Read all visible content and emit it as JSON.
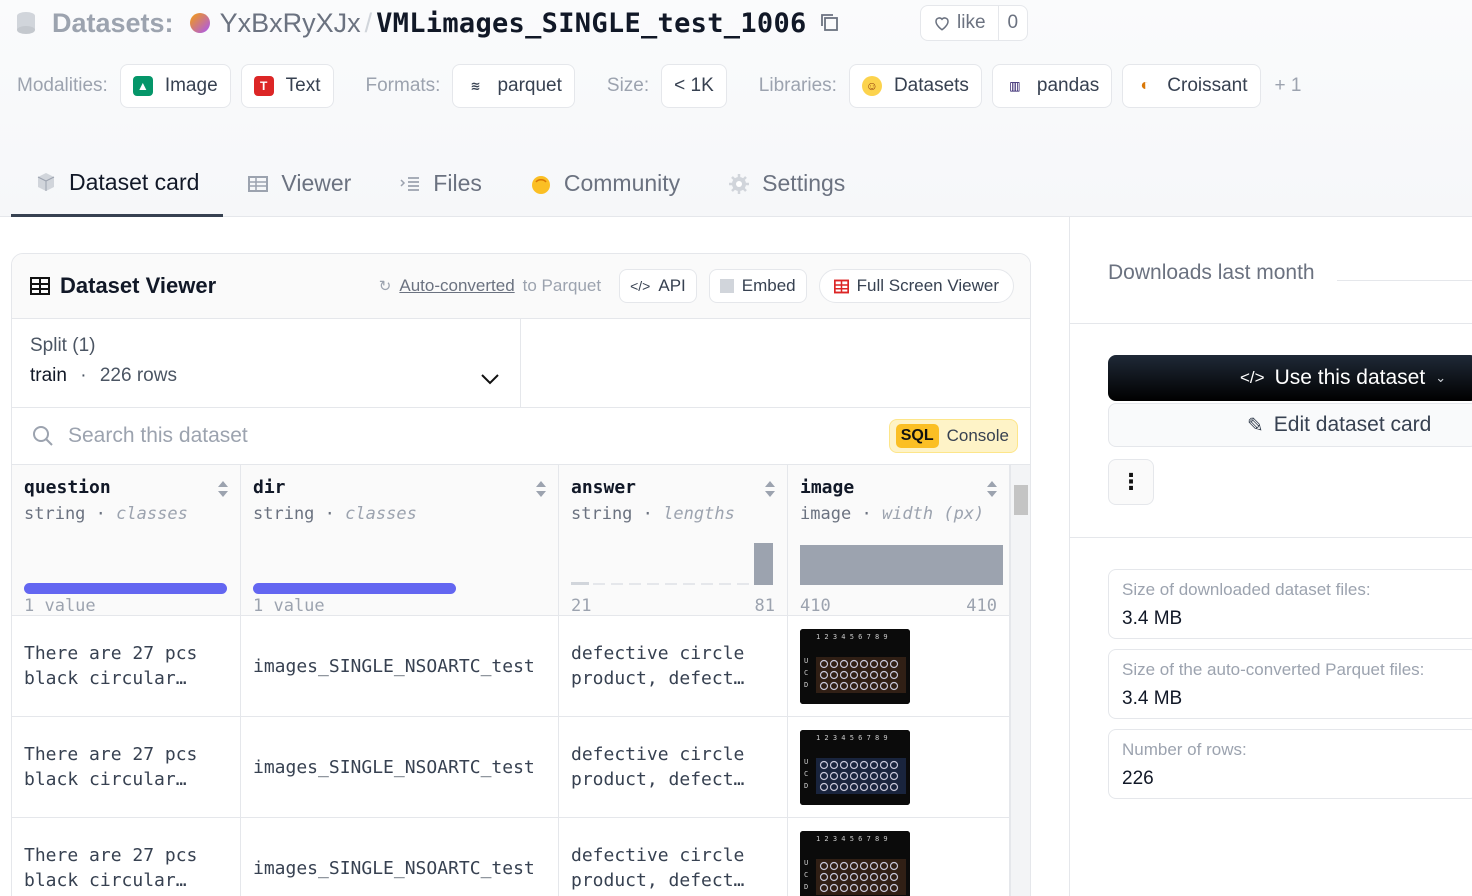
{
  "breadcrumb": {
    "label": "Datasets:",
    "org": "YxBxRyXJx",
    "separator": "/",
    "name": "VMLimages_SINGLE_test_1006"
  },
  "like": {
    "label": "like",
    "count": "0"
  },
  "tags": {
    "modalities_label": "Modalities:",
    "modalities": [
      "Image",
      "Text"
    ],
    "formats_label": "Formats:",
    "formats": [
      "parquet"
    ],
    "size_label": "Size:",
    "size": "< 1K",
    "libraries_label": "Libraries:",
    "libraries": [
      "Datasets",
      "pandas",
      "Croissant"
    ],
    "more": "+ 1"
  },
  "tabs": [
    {
      "label": "Dataset card",
      "icon": "cube-icon",
      "active": true
    },
    {
      "label": "Viewer",
      "icon": "table-icon"
    },
    {
      "label": "Files",
      "icon": "files-icon"
    },
    {
      "label": "Community",
      "icon": "community-icon"
    },
    {
      "label": "Settings",
      "icon": "gear-icon"
    }
  ],
  "viewer": {
    "title": "Dataset Viewer",
    "auto_link": "Auto-converted",
    "auto_rest": "to Parquet",
    "api": "API",
    "embed": "Embed",
    "fullscreen": "Full Screen Viewer",
    "split_label": "Split (1)",
    "split_name": "train",
    "split_dot": "·",
    "split_rows": "226 rows",
    "search_placeholder": "Search this dataset",
    "sql_badge": "SQL",
    "sql_label": "Console",
    "columns": [
      {
        "name": "question",
        "type": "string",
        "stat": "classes",
        "footer_left": "1 value",
        "footer_right": ""
      },
      {
        "name": "dir",
        "type": "string",
        "stat": "classes",
        "footer_left": "1 value",
        "footer_right": ""
      },
      {
        "name": "answer",
        "type": "string",
        "stat": "lengths",
        "footer_left": "21",
        "footer_right": "81"
      },
      {
        "name": "image",
        "type": "image",
        "stat": "width (px)",
        "footer_left": "410",
        "footer_right": "410"
      }
    ],
    "type_sep": "·",
    "rows": [
      {
        "question": "There are 27 pcs black circular…",
        "dir": "images_SINGLE_NSOARTC_test",
        "answer": "defective circle product, defect…"
      },
      {
        "question": "There are 27 pcs black circular…",
        "dir": "images_SINGLE_NSOARTC_test",
        "answer": "defective circle product, defect…"
      },
      {
        "question": "There are 27 pcs black circular…",
        "dir": "images_SINGLE_NSOARTC_test",
        "answer": "defective circle product, defect…"
      }
    ]
  },
  "sidebar": {
    "downloads_label": "Downloads last month",
    "use_label": "Use this dataset",
    "edit_label": "Edit dataset card",
    "stats": [
      {
        "label": "Size of downloaded dataset files:",
        "value": "3.4 MB"
      },
      {
        "label": "Size of the auto-converted Parquet files:",
        "value": "3.4 MB"
      },
      {
        "label": "Number of rows:",
        "value": "226"
      }
    ]
  },
  "colors": {
    "accent_bar": "#6366f1",
    "sql_badge": "#fbbf24",
    "use_button": "#000000"
  }
}
